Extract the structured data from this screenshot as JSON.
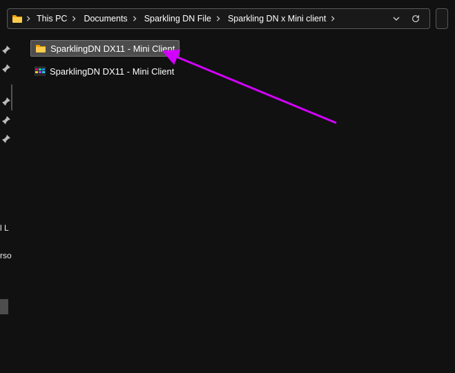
{
  "breadcrumb": {
    "segments": [
      "This PC",
      "Documents",
      "Sparkling DN  File",
      "Sparkling DN x Mini client"
    ]
  },
  "files": [
    {
      "type": "folder",
      "name": "SparklingDN DX11 - Mini Client",
      "selected": true
    },
    {
      "type": "exe",
      "name": "SparklingDN DX11 - Mini Client",
      "selected": false
    }
  ],
  "sidebar": {
    "cut_labels": [
      "l L",
      "rso"
    ]
  },
  "annotation": {
    "arrow_color": "#d400ff"
  }
}
